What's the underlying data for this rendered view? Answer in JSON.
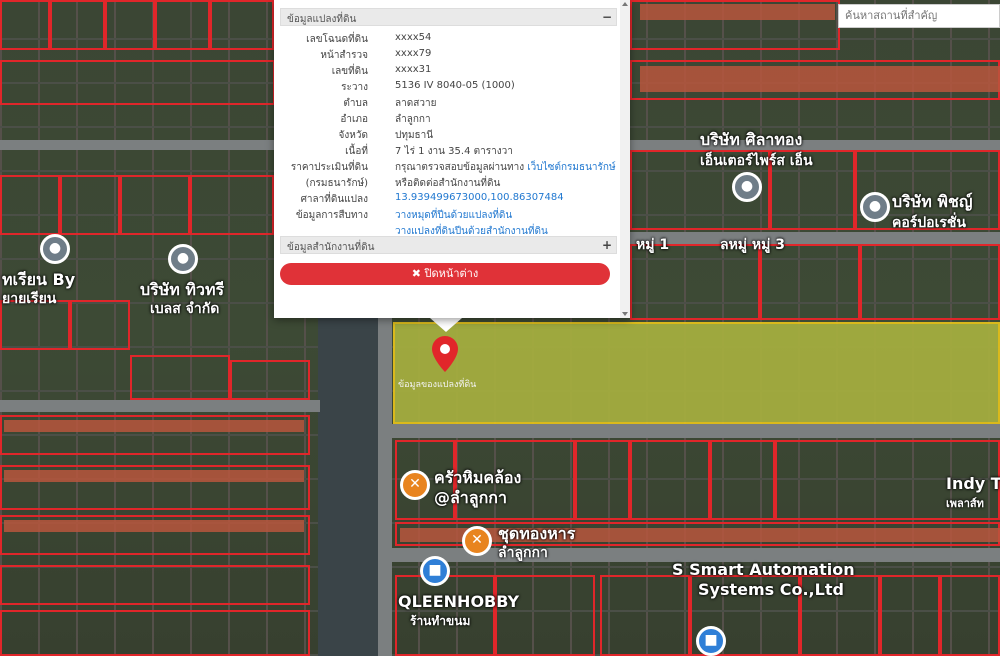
{
  "search": {
    "placeholder": "ค้นหาสถานที่สำคัญ"
  },
  "popup": {
    "section1_title": "ข้อมูลแปลงที่ดิน",
    "section1_toggle": "−",
    "rows": [
      {
        "label": "เลขโฉนดที่ดิน",
        "value": "xxxx54"
      },
      {
        "label": "หน้าสำรวจ",
        "value": "xxxx79"
      },
      {
        "label": "เลขที่ดิน",
        "value": "xxxx31"
      },
      {
        "label": "ระวาง",
        "value": "5136 IV 8040-05 (1000)"
      },
      {
        "label": "ตำบล",
        "value": "ลาดสวาย"
      },
      {
        "label": "อำเภอ",
        "value": "ลำลูกกา"
      },
      {
        "label": "จังหวัด",
        "value": "ปทุมธานี"
      },
      {
        "label": "เนื้อที่",
        "value": "7 ไร่ 1 งาน 35.4 ตารางวา"
      },
      {
        "label": "ราคาประเมินที่ดิน",
        "value": "กรุณาตรวจสอบข้อมูลผ่านทาง",
        "link": "เว็บไซต์กรมธนารักษ์"
      },
      {
        "label": "(กรมธนารักษ์)",
        "value": "หรือติดต่อสำนักงานที่ดิน"
      },
      {
        "label": "ศาลาที่ดินแปลง",
        "value": "",
        "link": "13.939499673000,100.86307484"
      },
      {
        "label": "ข้อมูลการสืบทาง",
        "value": "",
        "link": "วางหมุดที่ปีนด้วยแปลงที่ดิน"
      },
      {
        "label": "",
        "value": "",
        "link": "วางแปลงที่ดินปีนด้วยสำนักงานที่ดิน"
      }
    ],
    "section2_title": "ข้อมูลสำนักงานที่ดิน",
    "section2_toggle": "+",
    "close_label": "✖ ปิดหน้าต่าง"
  },
  "map": {
    "highlight_label": "ข้อมูลของแปลงที่ดิน",
    "roads": [
      "หมู่ 1",
      "ลหมู่ หมู่ 3"
    ],
    "pois": [
      {
        "name": "บริษัท ศิลาทอง",
        "sub": "เอ็นเตอร์ไพร์ส เอ็น",
        "icon": "gray"
      },
      {
        "name": "บริษัท พิชญ์",
        "sub": "คอร์ปอเรชั่น",
        "icon": "gray"
      },
      {
        "name": "ทเรียน By",
        "sub": "ยายเรียน",
        "icon": "gray"
      },
      {
        "name": "บริษัท ทิวทรี",
        "sub": "เบลส จำกัด",
        "icon": "gray"
      },
      {
        "name": "ครัวหิมคล้อง",
        "sub": "@ลำลูกกา",
        "icon": "orange"
      },
      {
        "name": "ชุดทองหาร",
        "sub": "ลำลูกกา",
        "icon": "orange"
      },
      {
        "name": "QLEENHOBBY",
        "sub": "ร้านทำขนม",
        "icon": "blue"
      },
      {
        "name": "S Smart Automation",
        "sub": "Systems Co.,Ltd",
        "icon": "blue"
      },
      {
        "name": "Indy T",
        "sub": "เพลาส์ท",
        "icon": "none"
      }
    ]
  },
  "colors": {
    "parcel_border": "#e0262a",
    "highlight_fill": "#a7b03f",
    "close_button": "#e03238",
    "link": "#2178d0"
  }
}
